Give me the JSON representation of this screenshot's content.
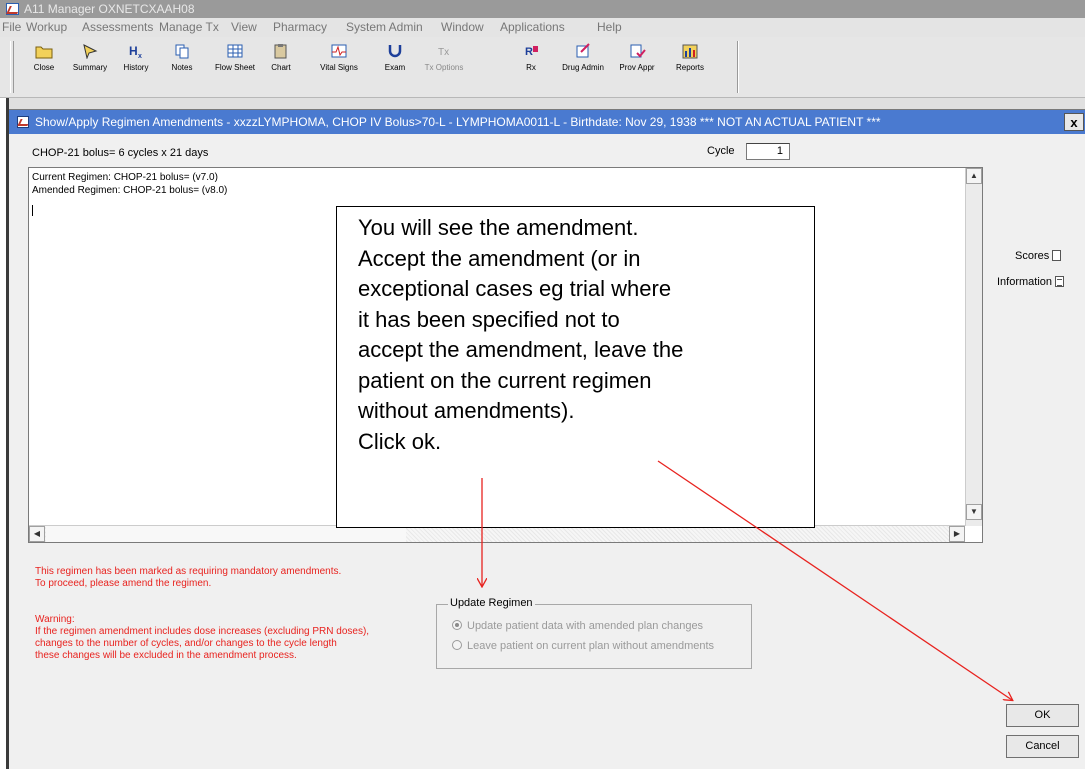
{
  "app": {
    "title": "A11 Manager OXNETCXAAH08"
  },
  "menu": [
    "File",
    "Workup",
    "Assessments",
    "Manage Tx",
    "View",
    "Pharmacy",
    "System Admin",
    "Window",
    "Applications",
    "Help"
  ],
  "toolbar": [
    {
      "label": "Close",
      "icon": "folder-icon",
      "enabled": true
    },
    {
      "label": "Summary",
      "icon": "summary-icon",
      "enabled": true
    },
    {
      "label": "History",
      "icon": "history-hx-icon",
      "enabled": true
    },
    {
      "label": "Notes",
      "icon": "notes-icon",
      "enabled": true
    },
    {
      "label": "Flow Sheet",
      "icon": "flow-sheet-grid-icon",
      "enabled": true
    },
    {
      "label": "Chart",
      "icon": "chart-clipboard-icon",
      "enabled": true
    },
    {
      "label": "Vital Signs",
      "icon": "vital-signs-icon",
      "enabled": true
    },
    {
      "label": "Exam",
      "icon": "stethoscope-icon",
      "enabled": true
    },
    {
      "label": "Tx Options",
      "icon": "tx-options-icon",
      "enabled": false
    },
    {
      "label": "Rx",
      "icon": "rx-icon",
      "enabled": true
    },
    {
      "label": "Drug Admin",
      "icon": "drug-admin-icon",
      "enabled": true
    },
    {
      "label": "Prov Appr",
      "icon": "provider-approval-icon",
      "enabled": true
    },
    {
      "label": "Reports",
      "icon": "reports-bar-icon",
      "enabled": true
    }
  ],
  "dialog": {
    "title": "Show/Apply Regimen Amendments - xxzzLYMPHOMA, CHOP IV Bolus>70-L  - LYMPHOMA0011-L - Birthdate: Nov 29, 1938 *** NOT AN ACTUAL PATIENT ***",
    "close_label": "x",
    "regimen_summary": "CHOP-21 bolus=  6 cycles x 21 days",
    "cycle_label": "Cycle",
    "cycle_value": "1",
    "text_lines": [
      "Current Regimen: CHOP-21 bolus= (v7.0)",
      "Amended Regimen:   CHOP-21 bolus= (v8.0)"
    ],
    "side_links": [
      {
        "label": "Scores",
        "icon": "page-icon"
      },
      {
        "label": "Information",
        "icon": "document-lines-icon"
      }
    ],
    "mandatory_notice": "This regimen has been marked as requiring mandatory amendments.\nTo proceed, please amend the regimen.",
    "warning_title": "Warning:",
    "warning_text": "If the regimen amendment includes dose increases (excluding PRN doses),\nchanges to the number of cycles, and/or changes to the cycle length\nthese changes will be excluded in the amendment process.",
    "update_group": {
      "legend": "Update Regimen",
      "options": [
        {
          "label": "Update patient data with amended plan changes",
          "selected": true
        },
        {
          "label": "Leave patient on current plan without amendments",
          "selected": false
        }
      ]
    },
    "ok_label": "OK",
    "cancel_label": "Cancel"
  },
  "callout": {
    "text": "You will see the amendment.\nAccept the amendment (or in\nexceptional cases eg trial where\nit has been specified not to\naccept the amendment, leave the\npatient on the current regimen\nwithout amendments).\nClick ok."
  },
  "colors": {
    "dialog_titlebar": "#4a7ad0",
    "warning_text": "#e8231f",
    "annotation_arrow": "#e8231f"
  }
}
